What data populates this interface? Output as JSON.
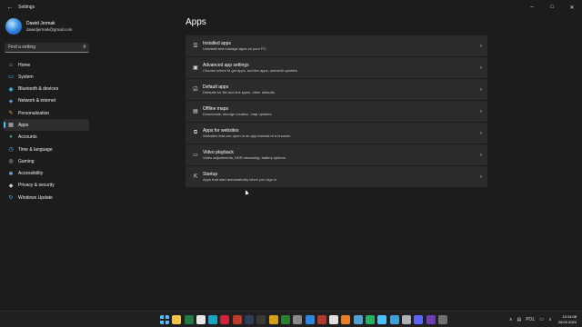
{
  "window": {
    "title": "Settings",
    "back_icon": "back-arrow-icon",
    "controls": [
      "minimize-icon",
      "maximize-icon",
      "close-icon"
    ]
  },
  "profile": {
    "name": "Dawid Jermak",
    "email": "dawidjermak@gmail.com"
  },
  "search": {
    "placeholder": "Find a setting"
  },
  "sidebar": {
    "items": [
      {
        "label": "Home",
        "icon": "home-icon",
        "color": "#d9d9d9",
        "glyph": "⌂"
      },
      {
        "label": "System",
        "icon": "monitor-icon",
        "color": "#4cc2ff",
        "glyph": "▭"
      },
      {
        "label": "Bluetooth & devices",
        "icon": "bluetooth-icon",
        "color": "#4cc2ff",
        "glyph": "◉"
      },
      {
        "label": "Network & internet",
        "icon": "wifi-icon",
        "color": "#6fb6ff",
        "glyph": "◈"
      },
      {
        "label": "Personalization",
        "icon": "brush-icon",
        "color": "#f0a35e",
        "glyph": "✎"
      },
      {
        "label": "Apps",
        "icon": "apps-icon",
        "color": "#cfcfcf",
        "glyph": "▦",
        "active": true
      },
      {
        "label": "Accounts",
        "icon": "person-icon",
        "color": "#3fb37f",
        "glyph": "●"
      },
      {
        "label": "Time & language",
        "icon": "globe-clock-icon",
        "color": "#4cc2ff",
        "glyph": "◷"
      },
      {
        "label": "Gaming",
        "icon": "controller-icon",
        "color": "#cfcfcf",
        "glyph": "◎"
      },
      {
        "label": "Accessibility",
        "icon": "accessibility-icon",
        "color": "#6fb6ff",
        "glyph": "✱"
      },
      {
        "label": "Privacy & security",
        "icon": "shield-icon",
        "color": "#cfcfcf",
        "glyph": "◆"
      },
      {
        "label": "Windows Update",
        "icon": "update-icon",
        "color": "#4cc2ff",
        "glyph": "↻"
      }
    ]
  },
  "main": {
    "title": "Apps",
    "cards": [
      {
        "title": "Installed apps",
        "subtitle": "Uninstall and manage apps on your PC",
        "icon": "list-icon",
        "glyph": "☰"
      },
      {
        "title": "Advanced app settings",
        "subtitle": "Choose where to get apps, archive apps, uninstall updates",
        "icon": "app-settings-icon",
        "glyph": "▣"
      },
      {
        "title": "Default apps",
        "subtitle": "Defaults for file and link types, other defaults",
        "icon": "default-apps-icon",
        "glyph": "☑"
      },
      {
        "title": "Offline maps",
        "subtitle": "Downloads, storage location, map updates",
        "icon": "map-icon",
        "glyph": "▤"
      },
      {
        "title": "Apps for websites",
        "subtitle": "Websites that can open in an app instead of a browser",
        "icon": "web-app-icon",
        "glyph": "⧉"
      },
      {
        "title": "Video playback",
        "subtitle": "Video adjustments, HDR streaming, battery options",
        "icon": "video-icon",
        "glyph": "▭"
      },
      {
        "title": "Startup",
        "subtitle": "Apps that start automatically when you sign in",
        "icon": "startup-icon",
        "glyph": "⇱"
      }
    ],
    "chevron": "›"
  },
  "taskbar": {
    "apps": [
      {
        "name": "start-icon",
        "color": "#4cc2ff"
      },
      {
        "name": "file-explorer-icon",
        "color": "#f4c542"
      },
      {
        "name": "excel-icon",
        "color": "#1f7a45"
      },
      {
        "name": "chrome-icon",
        "color": "#e6e6e6"
      },
      {
        "name": "edge-icon",
        "color": "#1aa3c4"
      },
      {
        "name": "opera-icon",
        "color": "#d1243a"
      },
      {
        "name": "app-red-icon",
        "color": "#c0392b"
      },
      {
        "name": "steam-icon",
        "color": "#2b3f5c"
      },
      {
        "name": "app-dots-icon",
        "color": "#3a3a3a"
      },
      {
        "name": "app-l-icon",
        "color": "#d4a017"
      },
      {
        "name": "app-green-icon",
        "color": "#2e7d32"
      },
      {
        "name": "settings-icon",
        "color": "#8a8a8a"
      },
      {
        "name": "mail-icon",
        "color": "#2e86de"
      },
      {
        "name": "app-v-icon",
        "color": "#b03a2e"
      },
      {
        "name": "app-paper-icon",
        "color": "#e0e0e0"
      },
      {
        "name": "app-orange-icon",
        "color": "#e67e22"
      },
      {
        "name": "app-cup-icon",
        "color": "#4fa3d1"
      },
      {
        "name": "app-b-icon",
        "color": "#27ae60"
      },
      {
        "name": "app-check-icon",
        "color": "#4cc2ff"
      },
      {
        "name": "app-k-icon",
        "color": "#3aa0d8"
      },
      {
        "name": "app-p-icon",
        "color": "#b0b0b0"
      },
      {
        "name": "discord-icon",
        "color": "#5865f2"
      },
      {
        "name": "app-purple-icon",
        "color": "#6c3fb5"
      },
      {
        "name": "app-gray-icon",
        "color": "#707070"
      }
    ],
    "tray": {
      "chevron": "∧",
      "language": "POL",
      "clock_time": "13:14:08",
      "clock_date": "28.02.2024"
    }
  }
}
